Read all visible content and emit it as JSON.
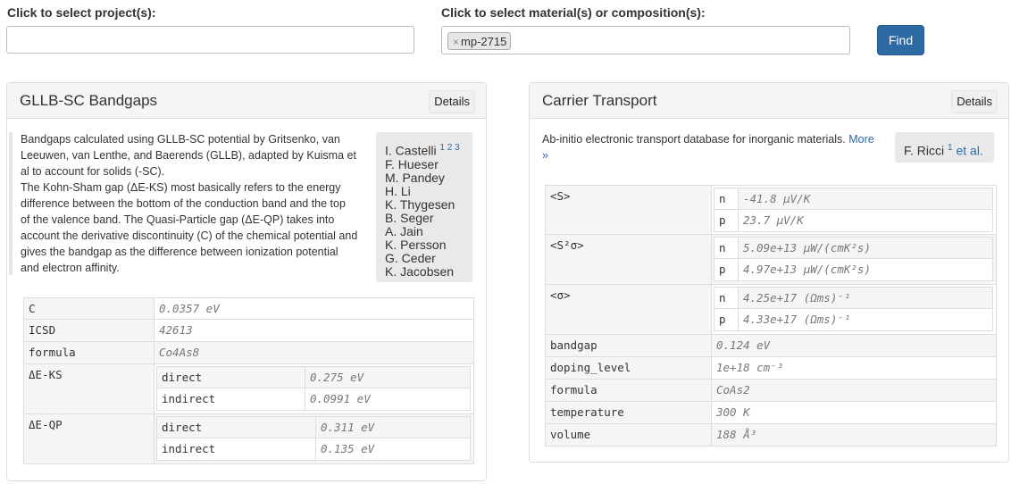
{
  "search": {
    "project_label": "Click to select project(s):",
    "project_value": "",
    "material_label": "Click to select material(s) or composition(s):",
    "material_chip": "mp-2715",
    "chip_remove": "×",
    "find_button": "Find"
  },
  "left_panel": {
    "title": "GLLB-SC Bandgaps",
    "details": "Details",
    "desc_lines": [
      "Bandgaps calculated using GLLB-SC potential by Gritsenko, van",
      "Leeuwen, van Lenthe, and Baerends (GLLB), adapted by Kuisma et",
      "al to account for solids (-SC).",
      "The Kohn-Sham gap (ΔE-KS) most basically refers to the energy",
      "difference between the bottom of the conduction band and the top",
      "of the valence band. The Quasi-Particle gap (ΔE-QP) takes into",
      "account the derivative discontinuity (C) of the chemical potential and",
      "gives the bandgap as the difference between ionization potential",
      "and electron affinity."
    ],
    "authors_first": "I. Castelli",
    "authors_refs": "1 2 3",
    "authors": [
      "F. Hueser",
      "M. Pandey",
      "H. Li",
      "K. Thygesen",
      "B. Seger",
      "A. Jain",
      "K. Persson",
      "G. Ceder",
      "K. Jacobsen"
    ],
    "table": {
      "C": "0.0357 eV",
      "ICSD": "42613",
      "formula": "Co4As8",
      "dEKS": "ΔE-KS",
      "dEQP": "ΔE-QP",
      "direct": "direct",
      "indirect": "indirect",
      "ks_direct": "0.275 eV",
      "ks_indirect": "0.0991 eV",
      "qp_direct": "0.311 eV",
      "qp_indirect": "0.135 eV",
      "k_C": "C",
      "k_ICSD": "ICSD",
      "k_formula": "formula"
    }
  },
  "right_panel": {
    "title": "Carrier Transport",
    "details": "Details",
    "desc": "Ab-initio electronic transport database for inorganic materials.",
    "more": "More",
    "more_arrow": "»",
    "author": "F. Ricci",
    "author_ref": "1",
    "etal": "et al.",
    "table": {
      "S": "<S>",
      "S2s": "<S²σ>",
      "sig": "<σ>",
      "n": "n",
      "p": "p",
      "S_n": "-41.8 μV/K",
      "S_p": "23.7 μV/K",
      "S2s_n": "5.09e+13 μW/(cmK²s)",
      "S2s_p": "4.97e+13 μW/(cmK²s)",
      "sig_n": "4.25e+17 (Ωms)⁻¹",
      "sig_p": "4.33e+17 (Ωms)⁻¹",
      "k_bandgap": "bandgap",
      "bandgap": "0.124 eV",
      "k_doping": "doping_level",
      "doping": "1e+18 cm⁻³",
      "k_formula": "formula",
      "formula": "CoAs2",
      "k_temperature": "temperature",
      "temperature": "300 K",
      "k_volume": "volume",
      "volume": "188 Å³"
    }
  }
}
